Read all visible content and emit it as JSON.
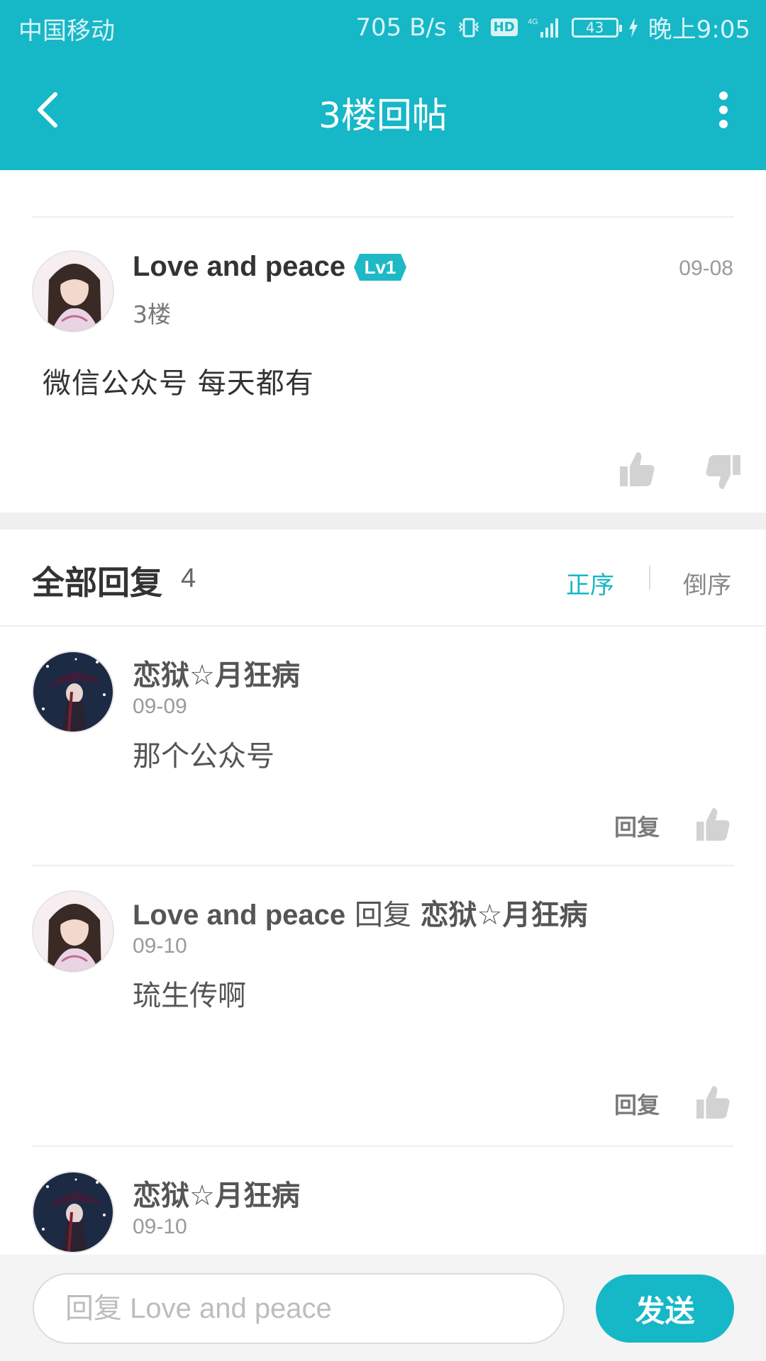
{
  "status_bar": {
    "carrier": "中国移动",
    "network_speed": "705 B/s",
    "hd": "HD",
    "signal": "4G",
    "battery": "43",
    "time": "晚上9:05"
  },
  "header": {
    "title": "3楼回帖"
  },
  "post": {
    "author": "Love and peace",
    "level": "Lv1",
    "floor": "3楼",
    "date": "09-08",
    "content": "微信公众号  每天都有"
  },
  "replies_header": {
    "title": "全部回复",
    "count": "4",
    "sort_asc": "正序",
    "sort_desc": "倒序"
  },
  "replies": [
    {
      "author": "恋狱☆月狂病",
      "reply_word": "",
      "reply_to": "",
      "date": "09-09",
      "content": "那个公众号",
      "reply_label": "回复"
    },
    {
      "author": "Love and peace",
      "reply_word": "回复",
      "reply_to": "恋狱☆月狂病",
      "date": "09-10",
      "content": "琉生传啊",
      "reply_label": "回复"
    },
    {
      "author": "恋狱☆月狂病",
      "reply_word": "",
      "reply_to": "",
      "date": "09-10",
      "content": "",
      "reply_label": ""
    }
  ],
  "input_bar": {
    "placeholder": "回复 Love and peace",
    "send_label": "发送"
  },
  "colors": {
    "accent": "#16b7c7",
    "text_primary": "#333333",
    "text_secondary": "#9a9a9a",
    "icon_gray": "#d2d2d2"
  }
}
